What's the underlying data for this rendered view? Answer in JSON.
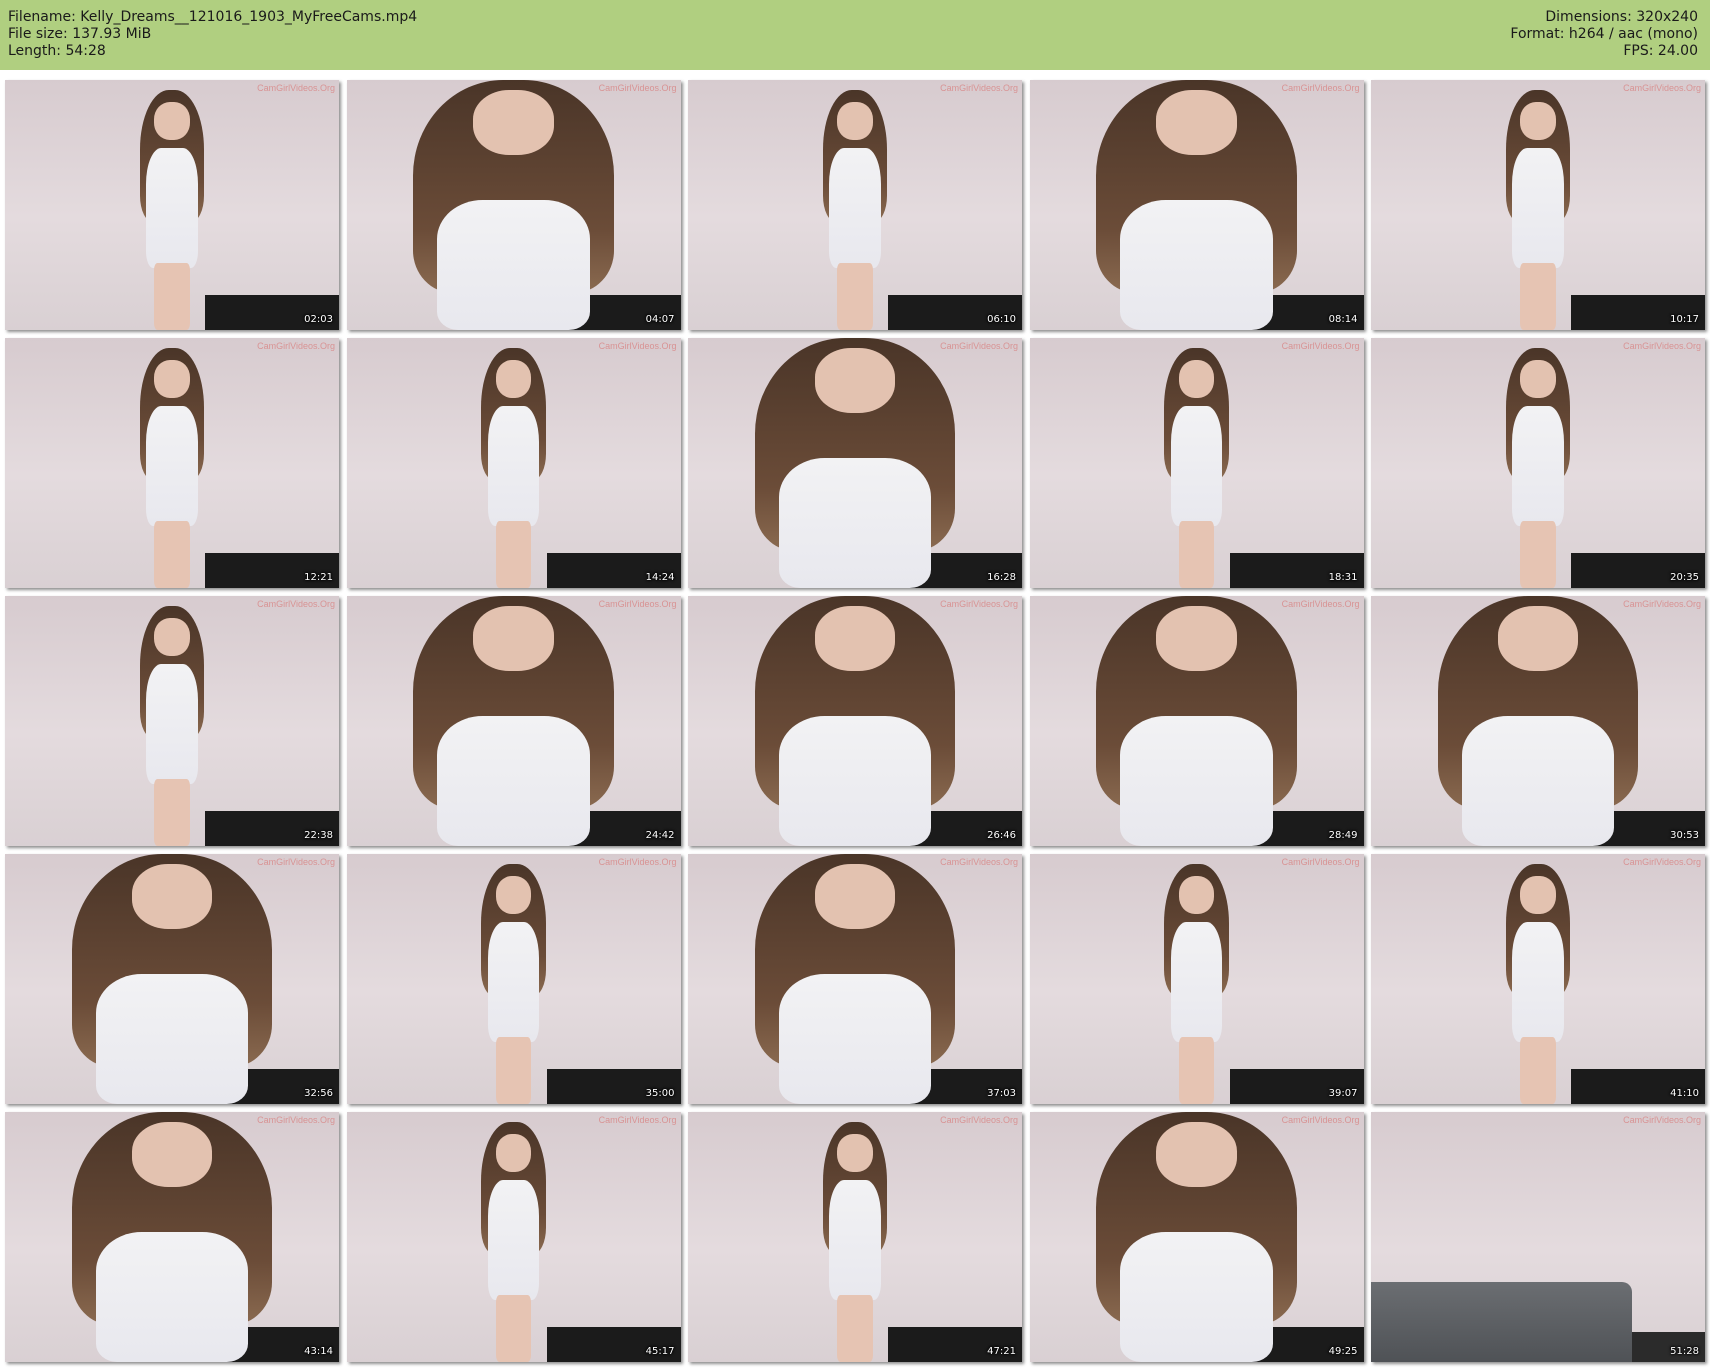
{
  "header": {
    "filename": "Filename: Kelly_Dreams__121016_1903_MyFreeCams.mp4",
    "filesize": "File size: 137.93 MiB",
    "length": "Length: 54:28",
    "dimensions": "Dimensions: 320x240",
    "format": "Format: h264 / aac (mono)",
    "fps": "FPS: 24.00",
    "background_color": "#b0cf80"
  },
  "thumbnails": [
    {
      "time": "02:03",
      "watermark": "CamGirlVideos.Org"
    },
    {
      "time": "04:07",
      "watermark": "CamGirlVideos.Org"
    },
    {
      "time": "06:10",
      "watermark": "CamGirlVideos.Org"
    },
    {
      "time": "08:14",
      "watermark": "CamGirlVideos.Org"
    },
    {
      "time": "10:17",
      "watermark": "CamGirlVideos.Org"
    },
    {
      "time": "12:21",
      "watermark": "CamGirlVideos.Org"
    },
    {
      "time": "14:24",
      "watermark": "CamGirlVideos.Org"
    },
    {
      "time": "16:28",
      "watermark": "CamGirlVideos.Org"
    },
    {
      "time": "18:31",
      "watermark": "CamGirlVideos.Org"
    },
    {
      "time": "20:35",
      "watermark": "CamGirlVideos.Org"
    },
    {
      "time": "22:38",
      "watermark": "CamGirlVideos.Org"
    },
    {
      "time": "24:42",
      "watermark": "CamGirlVideos.Org"
    },
    {
      "time": "26:46",
      "watermark": "CamGirlVideos.Org"
    },
    {
      "time": "28:49",
      "watermark": "CamGirlVideos.Org"
    },
    {
      "time": "30:53",
      "watermark": "CamGirlVideos.Org"
    },
    {
      "time": "32:56",
      "watermark": "CamGirlVideos.Org"
    },
    {
      "time": "35:00",
      "watermark": "CamGirlVideos.Org"
    },
    {
      "time": "37:03",
      "watermark": "CamGirlVideos.Org"
    },
    {
      "time": "39:07",
      "watermark": "CamGirlVideos.Org"
    },
    {
      "time": "41:10",
      "watermark": "CamGirlVideos.Org"
    },
    {
      "time": "43:14",
      "watermark": "CamGirlVideos.Org"
    },
    {
      "time": "45:17",
      "watermark": "CamGirlVideos.Org"
    },
    {
      "time": "47:21",
      "watermark": "CamGirlVideos.Org"
    },
    {
      "time": "49:25",
      "watermark": "CamGirlVideos.Org"
    },
    {
      "time": "51:28",
      "watermark": "CamGirlVideos.Org"
    }
  ]
}
